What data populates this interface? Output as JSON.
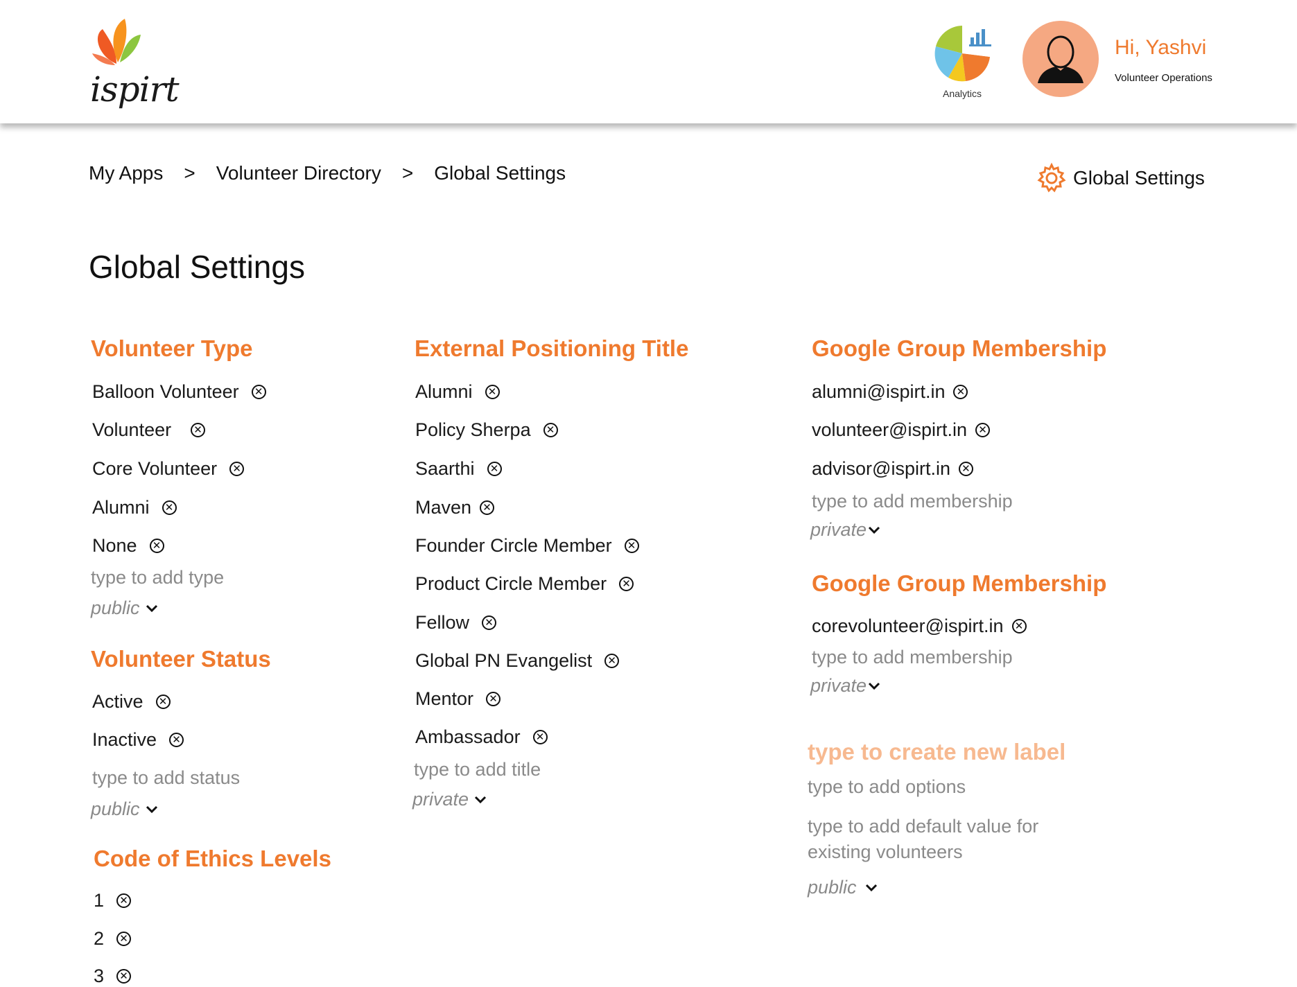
{
  "header": {
    "logo_text": "ispirt",
    "analytics_label": "Analytics",
    "greeting": "Hi, Yashvi",
    "role": "Volunteer Operations"
  },
  "breadcrumb": {
    "items": [
      "My Apps",
      "Volunteer Directory",
      "Global Settings"
    ],
    "separator": ">"
  },
  "settings_link": "Global Settings",
  "page_title": "Global Settings",
  "volunteer_type": {
    "title": "Volunteer Type",
    "items": [
      "Balloon Volunteer",
      "Volunteer",
      "Core Volunteer",
      "Alumni",
      "None"
    ],
    "placeholder": "type to add type",
    "visibility": "public"
  },
  "volunteer_status": {
    "title": "Volunteer Status",
    "items": [
      "Active",
      "Inactive"
    ],
    "placeholder": "type to add status",
    "visibility": "public"
  },
  "code_of_ethics": {
    "title": "Code of Ethics Levels",
    "items": [
      "1",
      "2",
      "3"
    ]
  },
  "external_title": {
    "title": "External Positioning Title",
    "items": [
      "Alumni",
      "Policy Sherpa",
      "Saarthi",
      "Maven",
      "Founder Circle Member",
      "Product Circle Member",
      "Fellow",
      "Global PN Evangelist",
      "Mentor",
      "Ambassador"
    ],
    "placeholder": "type to add title",
    "visibility": "private"
  },
  "google_group_1": {
    "title": "Google Group Membership",
    "items": [
      "alumni@ispirt.in",
      "volunteer@ispirt.in",
      "advisor@ispirt.in"
    ],
    "placeholder": "type to add membership",
    "visibility": "private"
  },
  "google_group_2": {
    "title": "Google Group Membership",
    "items": [
      "corevolunteer@ispirt.in"
    ],
    "placeholder": "type to add membership",
    "visibility": "private"
  },
  "new_label": {
    "title": "type to create new label",
    "options_placeholder": "type to add options",
    "default_placeholder_line1": "type to add default value for",
    "default_placeholder_line2": "existing volunteers",
    "visibility": "public"
  },
  "colors": {
    "accent": "#ef7a2e",
    "accent_light": "#f7b990",
    "placeholder": "#8a8a8a",
    "avatar_bg": "#f5a882"
  }
}
